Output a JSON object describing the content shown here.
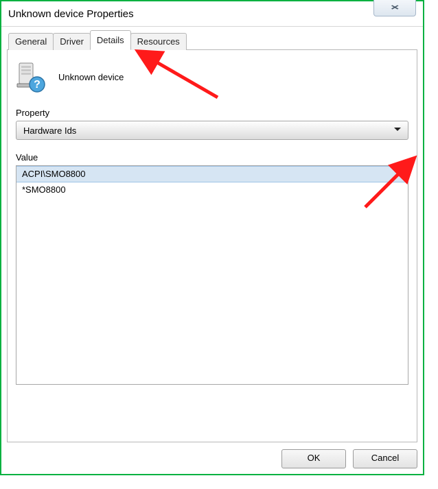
{
  "window": {
    "title": "Unknown device Properties"
  },
  "tabs": {
    "general": "General",
    "driver": "Driver",
    "details": "Details",
    "resources": "Resources",
    "active": "details"
  },
  "details": {
    "device_name": "Unknown device",
    "property_label": "Property",
    "property_value": "Hardware Ids",
    "value_label": "Value",
    "values": [
      "ACPI\\SMO8800",
      "*SMO8800"
    ]
  },
  "buttons": {
    "ok": "OK",
    "cancel": "Cancel"
  }
}
